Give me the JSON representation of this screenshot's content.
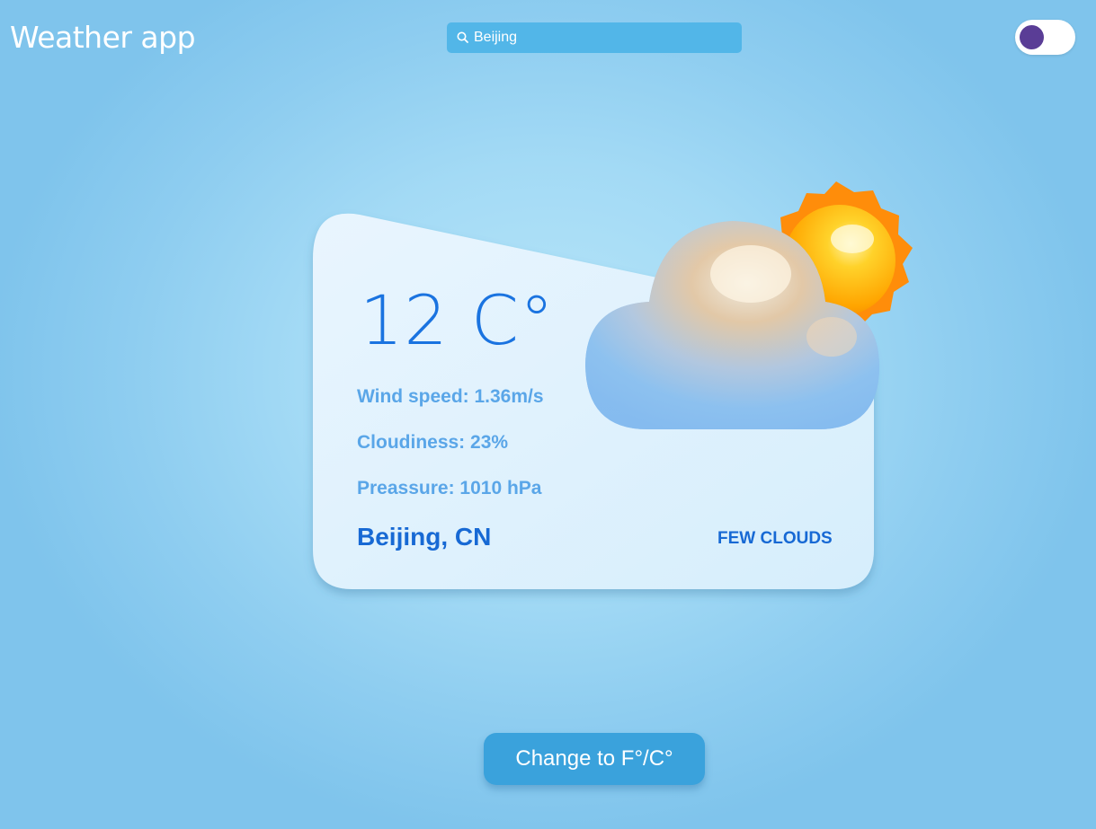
{
  "header": {
    "title": "Weather app",
    "search": {
      "value": "Beijing",
      "placeholder": "Beijing",
      "icon": "search-icon"
    },
    "theme_toggle": {
      "knob_color": "#5a3d96"
    }
  },
  "weather": {
    "temperature": "12 C°",
    "wind_speed": "Wind speed: 1.36m/s",
    "cloudiness": "Cloudiness: 23%",
    "pressure": "Preassure: 1010 hPa",
    "location": "Beijing, CN",
    "description": "FEW CLOUDS",
    "icon": "sun-behind-cloud-icon"
  },
  "footer": {
    "unit_button_label": "Change to F°/C°"
  },
  "colors": {
    "accent": "#1769d4",
    "detail_text": "#5aa6e8",
    "button": "#3aa2dc",
    "search_bg": "#52b6e8"
  }
}
